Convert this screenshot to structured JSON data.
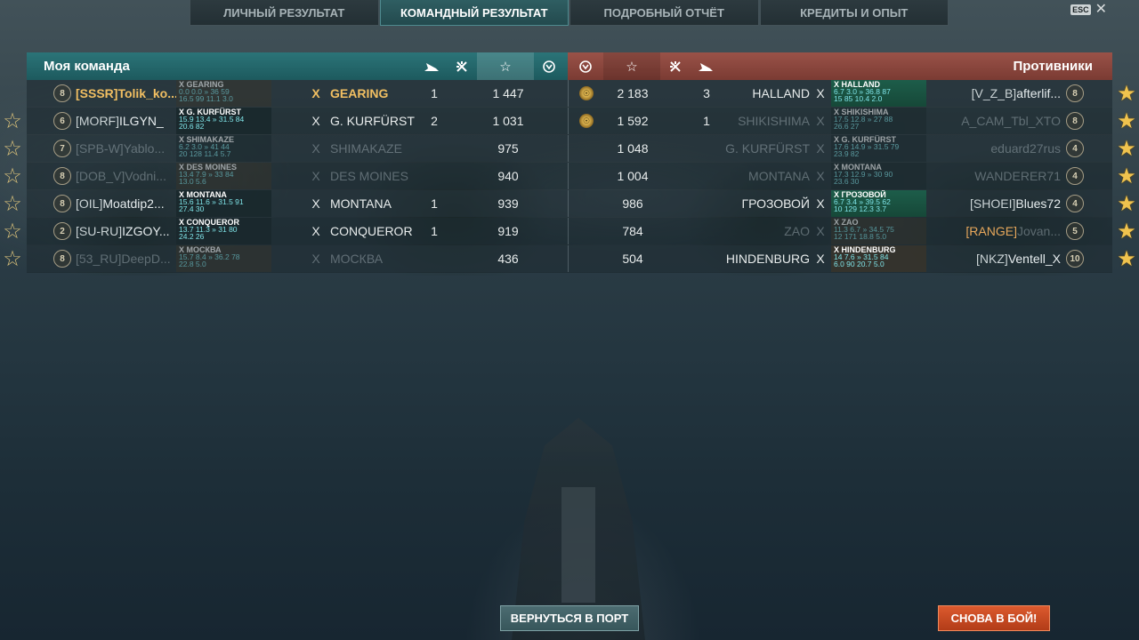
{
  "tabs": [
    {
      "label": "ЛИЧНЫЙ РЕЗУЛЬТАТ"
    },
    {
      "label": "КОМАНДНЫЙ РЕЗУЛЬТАТ"
    },
    {
      "label": "ПОДРОБНЫЙ ОТЧЁТ"
    },
    {
      "label": "КРЕДИТЫ И ОПЫТ"
    }
  ],
  "esc": {
    "key": "ESC",
    "close": "✕"
  },
  "header": {
    "my_team": "Моя команда",
    "enemies": "Противники"
  },
  "left_rows": [
    {
      "star": "",
      "rank": "8",
      "clan": "[SSSR]",
      "name": "Tolik_ko...",
      "tier": "X",
      "ship": "GEARING",
      "kills": "1",
      "score": "1 447",
      "style": "hl",
      "card": {
        "title": "X GEARING",
        "l1": "0.0 0.0 » 36  59",
        "l2": "16.5 99   11.1 3.0",
        "style": "brown fade"
      }
    },
    {
      "star": "☆",
      "rank": "6",
      "clan": "[MORF]",
      "name": "ILGYN_",
      "tier": "X",
      "ship": "G. KURFÜRST",
      "kills": "2",
      "score": "1 031",
      "style": "",
      "card": {
        "title": "X G. KURFÜRST",
        "l1": "15.9 13.4 » 31.5  84",
        "l2": "20.6 82",
        "style": ""
      }
    },
    {
      "star": "☆",
      "rank": "7",
      "clan": "[SPB-W]",
      "name": "Yablo...",
      "tier": "X",
      "ship": "SHIMAKAZE",
      "kills": "",
      "score": "975",
      "style": "dim",
      "card": {
        "title": "X SHIMAKAZE",
        "l1": "6.2 3.0 » 41  44",
        "l2": "20 128   11.4 5.7",
        "style": "fade"
      }
    },
    {
      "star": "☆",
      "rank": "8",
      "clan": "[DOB_V]",
      "name": "Vodni...",
      "tier": "X",
      "ship": "DES MOINES",
      "kills": "",
      "score": "940",
      "style": "dim",
      "card": {
        "title": "X DES MOINES",
        "l1": "13.4 7.9 » 33  84",
        "l2": "13.0 5.6",
        "style": "brown fade"
      }
    },
    {
      "star": "☆",
      "rank": "8",
      "clan": "[OIL]",
      "name": "Moatdip2...",
      "tier": "X",
      "ship": "MONTANA",
      "kills": "1",
      "score": "939",
      "style": "",
      "card": {
        "title": "X MONTANA",
        "l1": "15.6 11.6 » 31.5  91",
        "l2": "27.4 30",
        "style": ""
      }
    },
    {
      "star": "☆",
      "rank": "2",
      "clan": "[SU-RU]",
      "name": "IZGOY...",
      "tier": "X",
      "ship": "CONQUEROR",
      "kills": "1",
      "score": "919",
      "style": "",
      "card": {
        "title": "X CONQUEROR",
        "l1": "13.7 11.3 » 31  80",
        "l2": "24.2 26",
        "style": ""
      }
    },
    {
      "star": "☆",
      "rank": "8",
      "clan": "[53_RU]",
      "name": "DeepD...",
      "tier": "X",
      "ship": "МОСКВА",
      "kills": "",
      "score": "436",
      "style": "dim",
      "card": {
        "title": "X МОСКВА",
        "l1": "15.7 8.4 » 36.2  78",
        "l2": "22.8 5.0",
        "style": "brown fade"
      }
    }
  ],
  "right_rows": [
    {
      "medal": "☉",
      "score": "2 183",
      "kills": "3",
      "ship": "HALLAND",
      "tier": "X",
      "clan": "[V_Z_B]",
      "name": "afterlif...",
      "rank": "8",
      "star": "★",
      "style": "",
      "card": {
        "title": "X HALLAND",
        "l1": "6.7 3.0 » 36.8  87",
        "l2": "15 85   10.4 2.0",
        "style": "green"
      }
    },
    {
      "medal": "☉",
      "score": "1 592",
      "kills": "1",
      "ship": "SHIKISHIMA",
      "tier": "X",
      "clan": "",
      "name": "A_CAM_Tbl_XTO",
      "rank": "8",
      "star": "★",
      "style": "dim",
      "card": {
        "title": "X SHIKISHIMA",
        "l1": "17.5 12.8 » 27  88",
        "l2": "26.6 27",
        "style": "fade"
      }
    },
    {
      "medal": "",
      "score": "1 048",
      "kills": "",
      "ship": "G. KURFÜRST",
      "tier": "X",
      "clan": "",
      "name": "eduard27rus",
      "rank": "4",
      "star": "★",
      "style": "dim",
      "card": {
        "title": "X G. KURFÜRST",
        "l1": "17.6 14.9 » 31.5  79",
        "l2": "23.9 82",
        "style": "fade"
      }
    },
    {
      "medal": "",
      "score": "1 004",
      "kills": "",
      "ship": "MONTANA",
      "tier": "X",
      "clan": "",
      "name": "WANDERER71",
      "rank": "4",
      "star": "★",
      "style": "dim",
      "card": {
        "title": "X MONTANA",
        "l1": "17.3 12.9 » 30  90",
        "l2": "23.6 30",
        "style": "fade"
      }
    },
    {
      "medal": "",
      "score": "986",
      "kills": "",
      "ship": "ГРОЗОВОЙ",
      "tier": "X",
      "clan": "[SHOEI]",
      "name": "Blues72",
      "rank": "4",
      "star": "★",
      "style": "",
      "card": {
        "title": "X ГРОЗОВОЙ",
        "l1": "6.7 3.4 » 39.5  62",
        "l2": "10 129   12.3 3.7",
        "style": "green"
      }
    },
    {
      "medal": "",
      "score": "784",
      "kills": "",
      "ship": "ZAO",
      "tier": "X",
      "clan": "[RANGE]",
      "name": "Jovan...",
      "rank": "5",
      "star": "★",
      "style": "dim",
      "card": {
        "title": "X ZAO",
        "l1": "11.3 6.7 » 34.5  75",
        "l2": "12 171   18.8 5.0",
        "style": "brown fade"
      }
    },
    {
      "medal": "",
      "score": "504",
      "kills": "",
      "ship": "HINDENBURG",
      "tier": "X",
      "clan": "[NKZ]",
      "name": "Ventell_X",
      "rank": "10",
      "star": "★",
      "style": "",
      "card": {
        "title": "X HINDENBURG",
        "l1": "14 7.6 » 31.5  84",
        "l2": "6.0 90   20.7 5.0",
        "style": "brown"
      }
    }
  ],
  "buttons": {
    "port": "ВЕРНУТЬСЯ В ПОРТ",
    "battle": "СНОВА В БОЙ!"
  }
}
